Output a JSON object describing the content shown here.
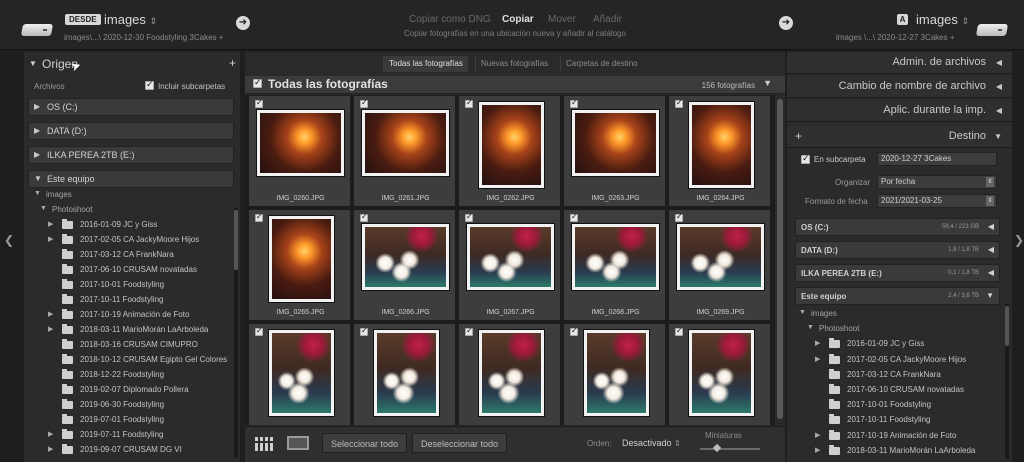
{
  "topbar": {
    "source_badge": "DESDE",
    "source_name": "images",
    "source_path": "images\\...\\ 2020-12-30 Foodstyling 3Cakes",
    "source_path_suffix": "+",
    "modes": [
      "Copiar como DNG",
      "Copiar",
      "Mover",
      "Añadir"
    ],
    "active_mode_index": 1,
    "mode_description": "Copiar fotografías en una ubicación nueva y añadir al catálogo",
    "dest_badge": "A",
    "dest_name": "images",
    "dest_path": "images \\...\\ 2020-12-27 3Cakes",
    "dest_path_suffix": "+",
    "arrow_glyph": "➜",
    "dropdown_glyph": "⇕"
  },
  "left_panel": {
    "title": "Origen",
    "plus": "+",
    "archivos_label": "Archivos",
    "include_subfolders_label": "Incluir subcarpetas",
    "include_subfolders_checked": true,
    "volumes": [
      {
        "name": "OS (C:)",
        "tri": "▶"
      },
      {
        "name": "DATA (D:)",
        "tri": "▶"
      },
      {
        "name": "ILKA PEREA 2TB (E:)",
        "tri": "▶"
      },
      {
        "name": "Este equipo",
        "tri": "▼"
      }
    ],
    "tree": [
      {
        "label": "images",
        "type": "sub",
        "tri": "▼"
      },
      {
        "label": "Photoshoot",
        "type": "sub",
        "tri": "▼"
      },
      {
        "label": "2016-01-09 JC y Giss",
        "type": "folder",
        "tri": "▶"
      },
      {
        "label": "2017-02-05 CA JackyMoore Hijos",
        "type": "folder",
        "tri": "▶"
      },
      {
        "label": "2017-03-12 CA FrankNara",
        "type": "folder",
        "tri": ""
      },
      {
        "label": "2017-06-10 CRUSAM novatadas",
        "type": "folder",
        "tri": ""
      },
      {
        "label": "2017-10-01 Foodstyling",
        "type": "folder",
        "tri": ""
      },
      {
        "label": "2017-10-11 Foodstyling",
        "type": "folder",
        "tri": ""
      },
      {
        "label": "2017-10-19 Animación de Foto",
        "type": "folder",
        "tri": "▶"
      },
      {
        "label": "2018-03-11 MarioMorán LaArboleda",
        "type": "folder",
        "tri": "▶"
      },
      {
        "label": "2018-03-16 CRUSAM CIMUPRO",
        "type": "folder",
        "tri": ""
      },
      {
        "label": "2018-10-12 CRUSAM Egipto Gel Colores",
        "type": "folder",
        "tri": ""
      },
      {
        "label": "2018-12-22 Foodstyling",
        "type": "folder",
        "tri": ""
      },
      {
        "label": "2019-02-07 Diplomado Pollera",
        "type": "folder",
        "tri": ""
      },
      {
        "label": "2019-06-30 Foodstyling",
        "type": "folder",
        "tri": ""
      },
      {
        "label": "2019-07-01 Foodstyling",
        "type": "folder",
        "tri": ""
      },
      {
        "label": "2019-07-11 Foodstyling",
        "type": "folder",
        "tri": "▶"
      },
      {
        "label": "2019-09-07 CRUSAM DG VI",
        "type": "folder",
        "tri": "▶"
      }
    ]
  },
  "center": {
    "tabs": [
      "Todas las fotografías",
      "Nuevas fotografías",
      "Carpetas de destino"
    ],
    "active_tab_index": 0,
    "header_title": "Todas las fotografías",
    "photo_count": "156 fotografías",
    "photos": [
      {
        "file": "IMG_0260.JPG",
        "scene": "candle",
        "orient": "land"
      },
      {
        "file": "IMG_0261.JPG",
        "scene": "candle",
        "orient": "land"
      },
      {
        "file": "IMG_0262.JPG",
        "scene": "candle",
        "orient": "port"
      },
      {
        "file": "IMG_0263.JPG",
        "scene": "candle",
        "orient": "land"
      },
      {
        "file": "IMG_0264.JPG",
        "scene": "candle",
        "orient": "port"
      },
      {
        "file": "IMG_0265.JPG",
        "scene": "candle",
        "orient": "port"
      },
      {
        "file": "IMG_0266.JPG",
        "scene": "cake",
        "orient": "land"
      },
      {
        "file": "IMG_0267.JPG",
        "scene": "cake",
        "orient": "land"
      },
      {
        "file": "IMG_0268.JPG",
        "scene": "cake",
        "orient": "land"
      },
      {
        "file": "IMG_0269.JPG",
        "scene": "cake",
        "orient": "land"
      },
      {
        "file": "",
        "scene": "cake",
        "orient": "port"
      },
      {
        "file": "",
        "scene": "cake",
        "orient": "port"
      },
      {
        "file": "",
        "scene": "cake",
        "orient": "port"
      },
      {
        "file": "",
        "scene": "cake",
        "orient": "port"
      },
      {
        "file": "",
        "scene": "cake",
        "orient": "port"
      }
    ],
    "select_all": "Seleccionar todo",
    "deselect_all": "Deseleccionar todo",
    "order_label": "Orden:",
    "order_value": "Desactivado",
    "thumbnails_label": "Miniaturas"
  },
  "right_panel": {
    "sections": [
      "Admin. de archivos",
      "Cambio de nombre de archivo",
      "Aplic. durante la imp.",
      "Destino"
    ],
    "plus": "+",
    "in_subfolder_label": "En subcarpeta",
    "in_subfolder_checked": true,
    "in_subfolder_value": "2020-12-27 3Cakes",
    "organize_label": "Organizar",
    "organize_value": "Por fecha",
    "date_format_label": "Formato de fecha",
    "date_format_value": "2021/2021-03-25",
    "volumes": [
      {
        "name": "OS (C:)",
        "size": "59,4 / 223 GB",
        "tri": "◀"
      },
      {
        "name": "DATA (D:)",
        "size": "1,8 / 1,8 TB",
        "tri": "◀"
      },
      {
        "name": "ILKA PEREA 2TB (E:)",
        "size": "0,1 / 1,8 TB",
        "tri": "◀"
      },
      {
        "name": "Este equipo",
        "size": "2,4 / 3,6 TB",
        "tri": "▼"
      }
    ],
    "tree": [
      {
        "label": "images",
        "type": "sub",
        "tri": "▼"
      },
      {
        "label": "Photoshoot",
        "type": "sub",
        "tri": "▼"
      },
      {
        "label": "2016-01-09 JC y Giss",
        "type": "folder",
        "tri": "▶"
      },
      {
        "label": "2017-02-05 CA JackyMoore Hijos",
        "type": "folder",
        "tri": "▶"
      },
      {
        "label": "2017-03-12 CA FrankNara",
        "type": "folder",
        "tri": ""
      },
      {
        "label": "2017-06-10 CRUSAM novatadas",
        "type": "folder",
        "tri": ""
      },
      {
        "label": "2017-10-01 Foodstyling",
        "type": "folder",
        "tri": ""
      },
      {
        "label": "2017-10-11 Foodstyling",
        "type": "folder",
        "tri": ""
      },
      {
        "label": "2017-10-19 Animación de Foto",
        "type": "folder",
        "tri": "▶"
      },
      {
        "label": "2018-03-11 MarioMorán LaArboleda",
        "type": "folder",
        "tri": "▶"
      }
    ]
  },
  "colors": {
    "background": "#1e1e1e",
    "panel": "#2b2b2b",
    "active_text": "#e0e0e0",
    "muted_text": "#6a6a6a"
  }
}
